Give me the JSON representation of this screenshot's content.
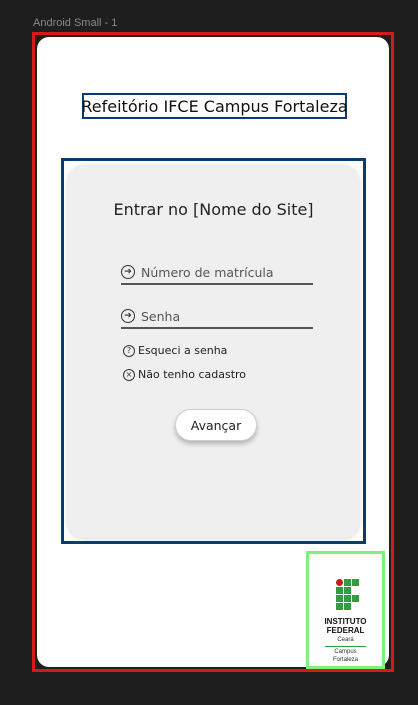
{
  "frame": {
    "label": "Android Small - 1"
  },
  "header": {
    "title": "Refeitório IFCE Campus Fortaleza"
  },
  "login": {
    "title": "Entrar no [Nome do Site]",
    "registration_placeholder": "Número de matrícula",
    "password_placeholder": "Senha",
    "forgot_password": "Esqueci a senha",
    "no_account": "Não tenho cadastro",
    "submit_label": "Avançar"
  },
  "logo": {
    "line1": "INSTITUTO",
    "line2": "FEDERAL",
    "line3": "Ceará",
    "line4": "Campus",
    "line5": "Fortaleza",
    "colors": {
      "green": "#2f9e41",
      "red": "#c8191e"
    }
  },
  "icons": {
    "field_icon": "arrow-circle-right-icon",
    "forgot_icon": "question-circle-icon",
    "no_account_icon": "x-circle-icon"
  },
  "colors": {
    "frame_outline": "#d61a1a",
    "section_outline": "#0b3c6e",
    "logo_outline": "#7ef07e",
    "card_bg": "#efefef"
  }
}
